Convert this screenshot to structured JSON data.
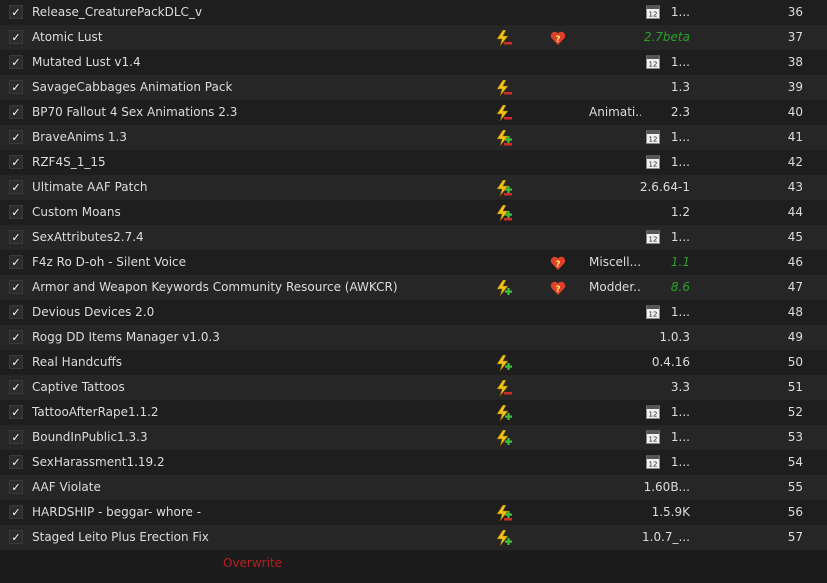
{
  "rows": [
    {
      "name": "Release_CreaturePackDLC_v",
      "conflict": "",
      "flag": false,
      "category": "",
      "date_icon": true,
      "version": "1...",
      "version_green": false,
      "priority": "36"
    },
    {
      "name": "Atomic Lust",
      "conflict": "lightning-minus",
      "flag": true,
      "category": "",
      "date_icon": false,
      "version": "2.7beta",
      "version_green": true,
      "priority": "37"
    },
    {
      "name": "Mutated Lust v1.4",
      "conflict": "",
      "flag": false,
      "category": "",
      "date_icon": true,
      "version": "1...",
      "version_green": false,
      "priority": "38"
    },
    {
      "name": "SavageCabbages Animation Pack",
      "conflict": "lightning-minus",
      "flag": false,
      "category": "",
      "date_icon": false,
      "version": "1.3",
      "version_green": false,
      "priority": "39"
    },
    {
      "name": "BP70 Fallout 4 Sex Animations 2.3",
      "conflict": "lightning-minus",
      "flag": false,
      "category": "Animati...",
      "date_icon": false,
      "version": "2.3",
      "version_green": false,
      "priority": "40"
    },
    {
      "name": "BraveAnims 1.3",
      "conflict": "lightning-plusminus",
      "flag": false,
      "category": "",
      "date_icon": true,
      "version": "1...",
      "version_green": false,
      "priority": "41"
    },
    {
      "name": "RZF4S_1_15",
      "conflict": "",
      "flag": false,
      "category": "",
      "date_icon": true,
      "version": "1...",
      "version_green": false,
      "priority": "42"
    },
    {
      "name": "Ultimate AAF Patch",
      "conflict": "lightning-plusminus",
      "flag": false,
      "category": "",
      "date_icon": false,
      "version": "2.6.64-1",
      "version_green": false,
      "priority": "43"
    },
    {
      "name": "Custom Moans",
      "conflict": "lightning-plusminus",
      "flag": false,
      "category": "",
      "date_icon": false,
      "version": "1.2",
      "version_green": false,
      "priority": "44"
    },
    {
      "name": "SexAttributes2.7.4",
      "conflict": "",
      "flag": false,
      "category": "",
      "date_icon": true,
      "version": "1...",
      "version_green": false,
      "priority": "45"
    },
    {
      "name": "F4z Ro D-oh - Silent Voice",
      "conflict": "",
      "flag": true,
      "category": "Miscell...",
      "date_icon": false,
      "version": "1.1",
      "version_green": true,
      "priority": "46"
    },
    {
      "name": "Armor and Weapon Keywords Community Resource (AWKCR)",
      "conflict": "lightning-plus",
      "flag": true,
      "category": "Modder...",
      "date_icon": false,
      "version": "8.6",
      "version_green": true,
      "priority": "47"
    },
    {
      "name": "Devious Devices 2.0",
      "conflict": "",
      "flag": false,
      "category": "",
      "date_icon": true,
      "version": "1...",
      "version_green": false,
      "priority": "48"
    },
    {
      "name": "Rogg DD Items Manager v1.0.3",
      "conflict": "",
      "flag": false,
      "category": "",
      "date_icon": false,
      "version": "1.0.3",
      "version_green": false,
      "priority": "49"
    },
    {
      "name": "Real Handcuffs",
      "conflict": "lightning-plus",
      "flag": false,
      "category": "",
      "date_icon": false,
      "version": "0.4.16",
      "version_green": false,
      "priority": "50"
    },
    {
      "name": "Captive Tattoos",
      "conflict": "lightning-minus",
      "flag": false,
      "category": "",
      "date_icon": false,
      "version": "3.3",
      "version_green": false,
      "priority": "51"
    },
    {
      "name": "TattooAfterRape1.1.2",
      "conflict": "lightning-plus",
      "flag": false,
      "category": "",
      "date_icon": true,
      "version": "1...",
      "version_green": false,
      "priority": "52"
    },
    {
      "name": "BoundInPublic1.3.3",
      "conflict": "lightning-plus",
      "flag": false,
      "category": "",
      "date_icon": true,
      "version": "1...",
      "version_green": false,
      "priority": "53"
    },
    {
      "name": "SexHarassment1.19.2",
      "conflict": "",
      "flag": false,
      "category": "",
      "date_icon": true,
      "version": "1...",
      "version_green": false,
      "priority": "54"
    },
    {
      "name": "AAF Violate",
      "conflict": "",
      "flag": false,
      "category": "",
      "date_icon": false,
      "version": "1.60B...",
      "version_green": false,
      "priority": "55"
    },
    {
      "name": "HARDSHIP - beggar- whore -",
      "conflict": "lightning-plusminus",
      "flag": false,
      "category": "",
      "date_icon": false,
      "version": "1.5.9K",
      "version_green": false,
      "priority": "56"
    },
    {
      "name": "Staged Leito Plus Erection Fix",
      "conflict": "lightning-plus",
      "flag": false,
      "category": "",
      "date_icon": false,
      "version": "1.0.7_...",
      "version_green": false,
      "priority": "57"
    }
  ],
  "checkmark": "✓",
  "overwrite_label": "Overwrite",
  "colors": {
    "bolt": "#f0c419",
    "plus": "#3ec23e",
    "minus": "#d12b2b",
    "flag": "#e0402a",
    "version_green": "#2aa02a",
    "overwrite": "#b81e1e"
  }
}
